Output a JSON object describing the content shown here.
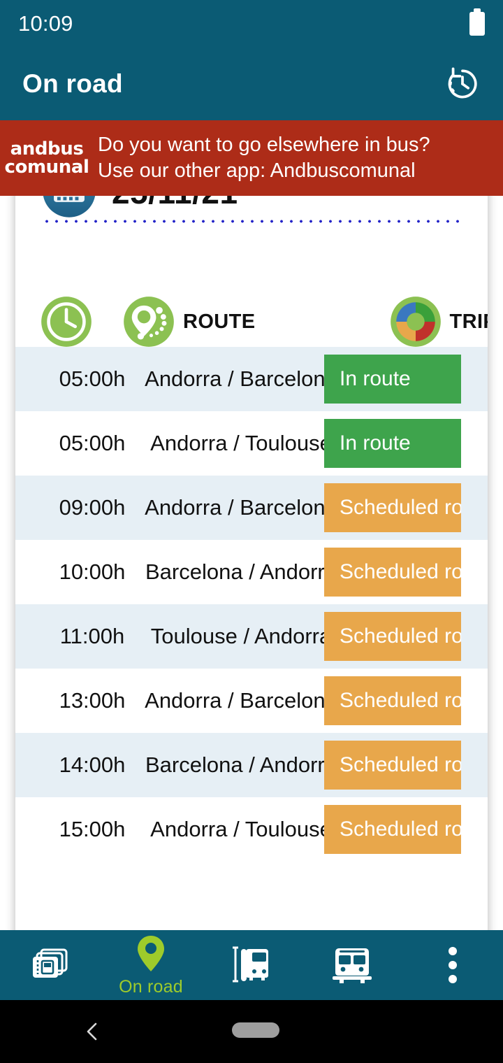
{
  "status_bar": {
    "time": "10:09",
    "battery_icon": "battery-full-icon"
  },
  "app_bar": {
    "title": "On road",
    "history_icon": "history-clock-icon"
  },
  "ad_banner": {
    "logo_line1": "andbus",
    "logo_line2": "comunal",
    "text_line1": "Do you want to go elsewhere in bus?",
    "text_line2": "Use our other app: Andbuscomunal",
    "background_color": "#ad2c18"
  },
  "schedule_card": {
    "date": "25/11/21",
    "calendar_icon": "calendar-icon",
    "columns": [
      {
        "icon": "clock-icon",
        "label": ""
      },
      {
        "icon": "location-pin-icon",
        "label": "ROUTE"
      },
      {
        "icon": "donut-chart-icon",
        "label": "TRIP STAT"
      }
    ],
    "rows": [
      {
        "time": "05:00h",
        "route": "Andorra / Barcelona",
        "status": "In route",
        "status_type": "in-route"
      },
      {
        "time": "05:00h",
        "route": "Andorra / Toulouse",
        "status": "In route",
        "status_type": "in-route"
      },
      {
        "time": "09:00h",
        "route": "Andorra / Barcelona",
        "status": "Scheduled ro",
        "status_type": "scheduled"
      },
      {
        "time": "10:00h",
        "route": "Barcelona / Andorra",
        "status": "Scheduled ro",
        "status_type": "scheduled"
      },
      {
        "time": "11:00h",
        "route": "Toulouse / Andorra",
        "status": "Scheduled ro",
        "status_type": "scheduled"
      },
      {
        "time": "13:00h",
        "route": "Andorra / Barcelona",
        "status": "Scheduled ro",
        "status_type": "scheduled"
      },
      {
        "time": "14:00h",
        "route": "Barcelona / Andorra",
        "status": "Scheduled ro",
        "status_type": "scheduled"
      },
      {
        "time": "15:00h",
        "route": "Andorra / Toulouse",
        "status": "Scheduled ro",
        "status_type": "scheduled"
      }
    ],
    "status_colors": {
      "in_route": "#3ea44c",
      "scheduled": "#e8a74b"
    }
  },
  "bottom_nav": {
    "active_color": "#9ecb2b",
    "background_color": "#0b5b74",
    "items": [
      {
        "icon": "cards-stack-icon",
        "label": "",
        "active": false
      },
      {
        "icon": "location-pin-icon",
        "label": "On road",
        "active": true
      },
      {
        "icon": "bus-stop-icon",
        "label": "",
        "active": false
      },
      {
        "icon": "bus-front-icon",
        "label": "",
        "active": false
      },
      {
        "icon": "more-vertical-icon",
        "label": "",
        "active": false
      }
    ]
  },
  "android_nav": {
    "back_icon": "chevron-back-icon",
    "home_indicator": "home-pill-indicator"
  }
}
